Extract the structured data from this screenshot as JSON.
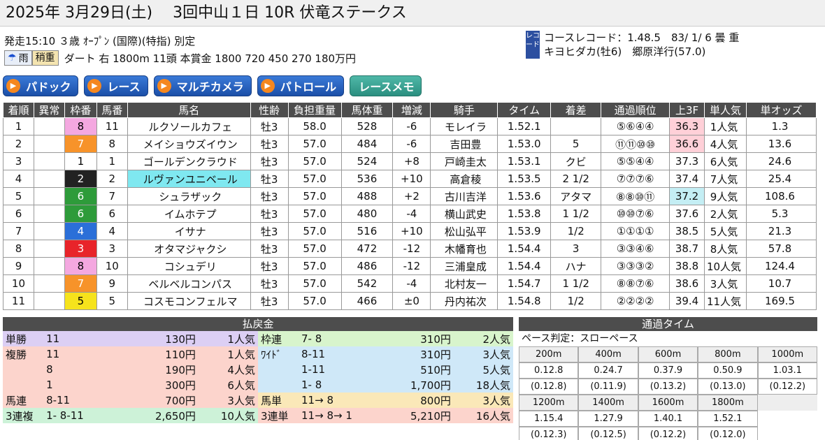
{
  "title": "2025年 3月29日(土)　 3回中山１日 10R 伏竜ステークス",
  "info_line1": "発走15:10 ３歳 ｵｰﾌﾟﾝ (国際)(特指) 別定",
  "weather": "雨",
  "track_condition": "稍重",
  "info_line2": "ダート 右 1800m 11頭 本賞金 1800 720 450 270 180万円",
  "record_tag": "レコード",
  "record_line1": "コースレコード：1.48.5　83/ 1/ 6 曇 重",
  "record_line2": "キヨヒダカ(牡6)　郷原洋行(57.0)",
  "buttons": [
    "パドック",
    "レース",
    "マルチカメラ",
    "パトロール",
    "レースメモ"
  ],
  "results": {
    "headers": [
      "着順",
      "異常",
      "枠番",
      "馬番",
      "馬名",
      "性齢",
      "負担重量",
      "馬体重",
      "増減",
      "騎手",
      "タイム",
      "着差",
      "通過順位",
      "上3F",
      "単人気",
      "単オッズ"
    ],
    "rows": [
      [
        "1",
        "",
        "8",
        "11",
        "ルクソールカフェ",
        "牡3",
        "58.0",
        "528",
        "-6",
        "モレイラ",
        "1.52.1",
        "",
        "⑤⑥④④",
        "36.3",
        "1人気",
        "1.3"
      ],
      [
        "2",
        "",
        "7",
        "8",
        "メイショウズイウン",
        "牡3",
        "57.0",
        "484",
        "-6",
        "吉田豊",
        "1.53.0",
        "5",
        "⑪⑪⑩⑩",
        "36.6",
        "4人気",
        "13.6"
      ],
      [
        "3",
        "",
        "1",
        "1",
        "ゴールデンクラウド",
        "牡3",
        "57.0",
        "524",
        "+8",
        "戸崎圭太",
        "1.53.1",
        "クビ",
        "⑤⑤④④",
        "37.3",
        "6人気",
        "24.6"
      ],
      [
        "4",
        "",
        "2",
        "2",
        "ルヴァンユニベール",
        "牡3",
        "57.0",
        "536",
        "+10",
        "高倉稜",
        "1.53.5",
        "2 1/2",
        "⑦⑦⑦⑥",
        "37.4",
        "7人気",
        "25.4"
      ],
      [
        "5",
        "",
        "6",
        "7",
        "シュラザック",
        "牡3",
        "57.0",
        "488",
        "+2",
        "古川吉洋",
        "1.53.6",
        "アタマ",
        "⑧⑧⑩⑪",
        "37.2",
        "9人気",
        "108.6"
      ],
      [
        "6",
        "",
        "6",
        "6",
        "イムホテプ",
        "牡3",
        "57.0",
        "480",
        "-4",
        "横山武史",
        "1.53.8",
        "1 1/2",
        "⑩⑩⑦⑥",
        "37.6",
        "2人気",
        "5.3"
      ],
      [
        "7",
        "",
        "4",
        "4",
        "イサナ",
        "牡3",
        "57.0",
        "516",
        "+10",
        "松山弘平",
        "1.53.9",
        "1/2",
        "①①①①",
        "38.5",
        "5人気",
        "21.3"
      ],
      [
        "8",
        "",
        "3",
        "3",
        "オタマジャクシ",
        "牡3",
        "57.0",
        "472",
        "-12",
        "木幡育也",
        "1.54.4",
        "3",
        "③③④⑥",
        "38.7",
        "8人気",
        "57.8"
      ],
      [
        "9",
        "",
        "8",
        "10",
        "コシュデリ",
        "牡3",
        "57.0",
        "486",
        "-12",
        "三浦皇成",
        "1.54.4",
        "ハナ",
        "③③③②",
        "38.8",
        "10人気",
        "124.4"
      ],
      [
        "10",
        "",
        "7",
        "9",
        "ベルベルコンパス",
        "牡3",
        "57.0",
        "542",
        "-4",
        "北村友一",
        "1.54.7",
        "1 1/2",
        "⑧⑧⑦⑥",
        "38.6",
        "3人気",
        "10.7"
      ],
      [
        "11",
        "",
        "5",
        "5",
        "コスモコンフェルマ",
        "牡3",
        "57.0",
        "466",
        "±0",
        "丹内祐次",
        "1.54.8",
        "1/2",
        "②②②②",
        "39.4",
        "11人気",
        "169.5"
      ]
    ]
  },
  "frame_colors": {
    "1": "#ffffff",
    "2": "#222222",
    "3": "#e8242a",
    "4": "#2b6fd8",
    "5": "#f6e31c",
    "6": "#2e9b3a",
    "7": "#f7932a",
    "8": "#f4a8e0"
  },
  "payouts": {
    "title": "払戻金",
    "left": [
      [
        "単勝",
        "11",
        "130円",
        "1人気"
      ],
      [
        "複勝",
        "11",
        "110円",
        "1人気"
      ],
      [
        "",
        "8",
        "190円",
        "4人気"
      ],
      [
        "",
        "1",
        "300円",
        "6人気"
      ],
      [
        "馬連",
        "8-11",
        "700円",
        "3人気"
      ],
      [
        "3連複",
        "1- 8-11",
        "2,650円",
        "10人気"
      ]
    ],
    "right": [
      [
        "枠連",
        "7- 8",
        "310円",
        "2人気"
      ],
      [
        "ﾜｲﾄﾞ",
        "8-11",
        "310円",
        "3人気"
      ],
      [
        "",
        "1-11",
        "510円",
        "5人気"
      ],
      [
        "",
        "1- 8",
        "1,700円",
        "18人気"
      ],
      [
        "馬単",
        "11→ 8",
        "800円",
        "3人気"
      ],
      [
        "3連単",
        "11→ 8→ 1",
        "5,210円",
        "16人気"
      ]
    ]
  },
  "passing": {
    "title": "通過タイム",
    "pace": "ペース判定：スローペース",
    "row1_headers": [
      "200m",
      "400m",
      "600m",
      "800m",
      "1000m"
    ],
    "row1_times": [
      "0.12.8",
      "0.24.7",
      "0.37.9",
      "0.50.9",
      "1.03.1"
    ],
    "row1_laps": [
      "(0.12.8)",
      "(0.11.9)",
      "(0.13.2)",
      "(0.13.0)",
      "(0.12.2)"
    ],
    "row2_headers": [
      "1200m",
      "1400m",
      "1600m",
      "1800m",
      ""
    ],
    "row2_times": [
      "1.15.4",
      "1.27.9",
      "1.40.1",
      "1.52.1",
      ""
    ],
    "row2_laps": [
      "(0.12.3)",
      "(0.12.5)",
      "(0.12.2)",
      "(0.12.0)",
      ""
    ]
  }
}
